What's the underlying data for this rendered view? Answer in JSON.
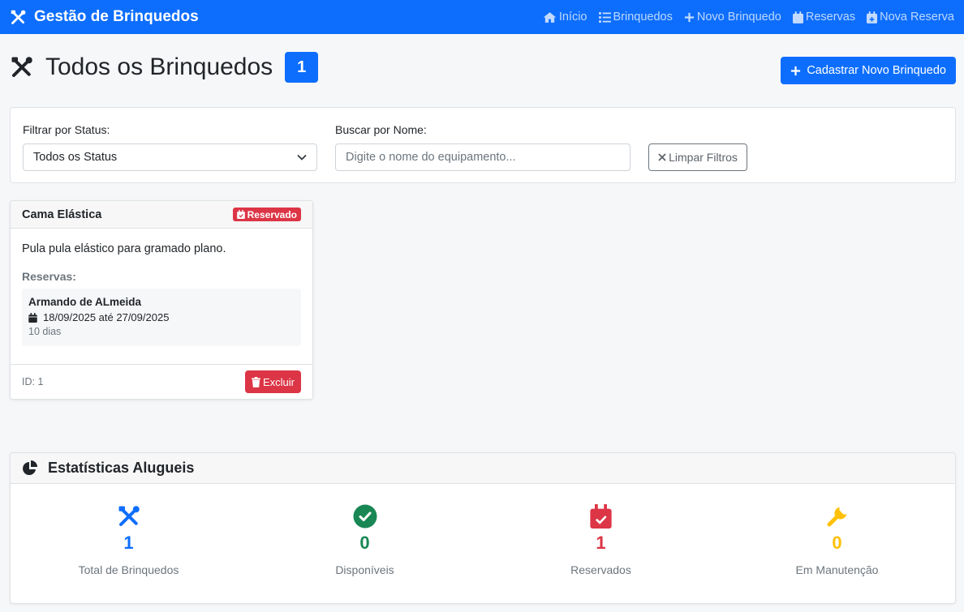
{
  "navbar": {
    "brand": "Gestão de Brinquedos",
    "links": [
      "Início",
      "Brinquedos",
      "Novo Brinquedo",
      "Reservas",
      "Nova Reserva"
    ]
  },
  "header": {
    "title": "Todos os Brinquedos",
    "count": "1",
    "add_button": "Cadastrar Novo Brinquedo"
  },
  "filters": {
    "status_label": "Filtrar por Status:",
    "status_selected": "Todos os Status",
    "search_label": "Buscar por Nome:",
    "search_placeholder": "Digite o nome do equipamento...",
    "search_value": "",
    "clear_button": "Limpar Filtros"
  },
  "toys": [
    {
      "name": "Cama Elástica",
      "status": "Reservado",
      "description": "Pula pula elástico para gramado plano.",
      "reservations_label": "Reservas:",
      "reservations": [
        {
          "client": "Armando de ALmeida",
          "dates": "18/09/2025 até 27/09/2025",
          "days": "10 dias"
        }
      ],
      "id_text": "ID: 1",
      "delete_button": "Excluir"
    }
  ],
  "stats": {
    "title": "Estatísticas Alugueis",
    "items": [
      {
        "value": "1",
        "label": "Total de Brinquedos",
        "icon": "tools-icon",
        "color": "#0d6efd"
      },
      {
        "value": "0",
        "label": "Disponíveis",
        "icon": "check-circle-icon",
        "color": "#198754"
      },
      {
        "value": "1",
        "label": "Reservados",
        "icon": "calendar-check-icon",
        "color": "#dc3545"
      },
      {
        "value": "0",
        "label": "Em Manutenção",
        "icon": "wrench-icon",
        "color": "#ffc107"
      }
    ]
  },
  "colors": {
    "primary": "#0d6efd",
    "danger": "#dc3545",
    "success": "#198754",
    "warning": "#ffc107"
  }
}
